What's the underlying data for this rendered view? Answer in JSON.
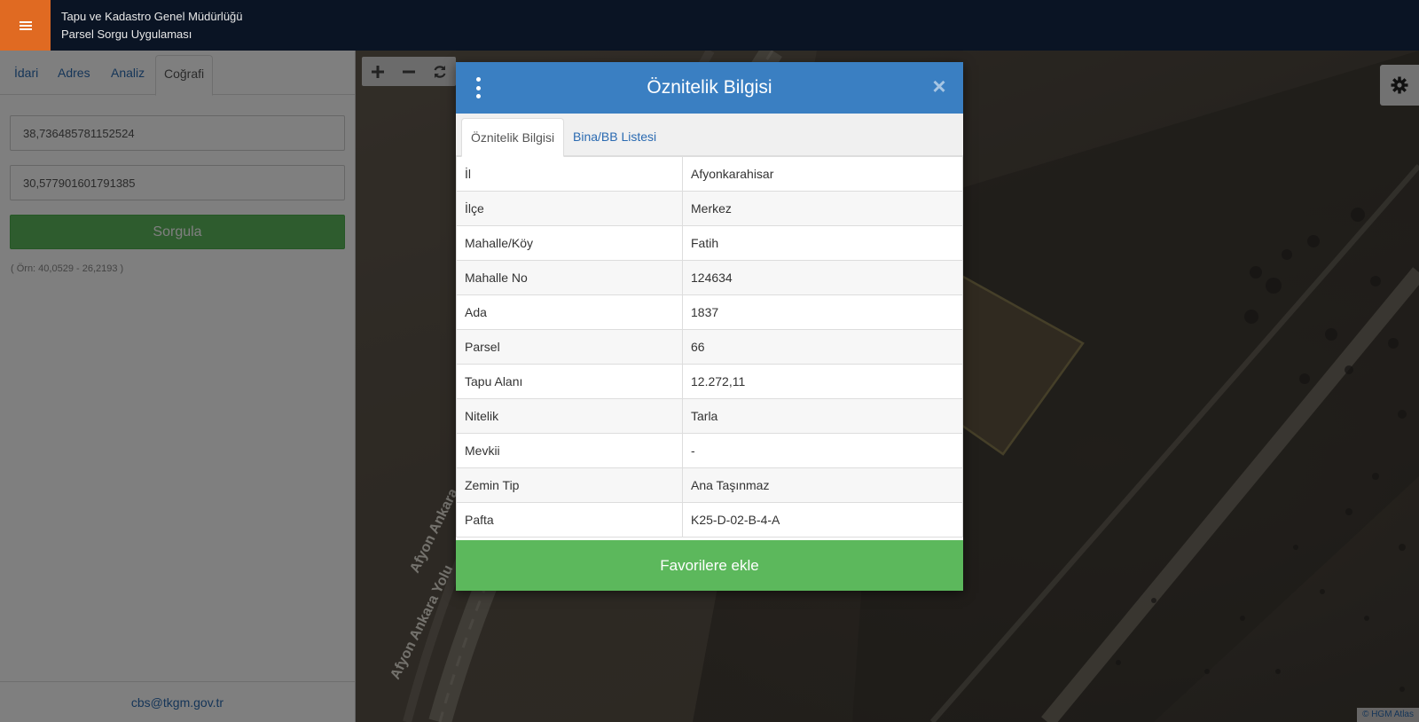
{
  "header": {
    "menu_icon": "hamburger-menu-icon",
    "title_line1": "Tapu ve Kadastro Genel Müdürlüğü",
    "title_line2": "Parsel Sorgu Uygulaması",
    "bg_color": "#0a1424",
    "accent_color": "#e06a22"
  },
  "left_panel": {
    "tabs": [
      {
        "label": "İdari"
      },
      {
        "label": "Adres"
      },
      {
        "label": "Analiz"
      },
      {
        "label": "Coğrafi",
        "active": true
      }
    ],
    "latitude_value": "38,736485781152524",
    "longitude_value": "30,577901601791385",
    "query_button": "Sorgula",
    "example_text": "( Örn: 40,0529 - 26,2193 )",
    "footer_email": "cbs@tkgm.gov.tr"
  },
  "map": {
    "toolbar_icons": [
      "zoom-in-icon",
      "zoom-out-icon",
      "refresh-icon"
    ],
    "road_label_1": "Afyon Ankara",
    "road_label_2": "Afyon Ankara Yolu",
    "settings_icon": "gear-icon",
    "attribution": "© HGM Atlas"
  },
  "modal": {
    "title": "Öznitelik Bilgisi",
    "menu_icon": "kebab-menu-icon",
    "close_icon": "close-icon",
    "tabs": [
      {
        "label": "Öznitelik Bilgisi",
        "active": true
      },
      {
        "label": "Bina/BB Listesi"
      }
    ],
    "rows": [
      {
        "key": "İl",
        "value": "Afyonkarahisar"
      },
      {
        "key": "İlçe",
        "value": "Merkez"
      },
      {
        "key": "Mahalle/Köy",
        "value": "Fatih"
      },
      {
        "key": "Mahalle No",
        "value": "124634"
      },
      {
        "key": "Ada",
        "value": "1837"
      },
      {
        "key": "Parsel",
        "value": "66"
      },
      {
        "key": "Tapu Alanı",
        "value": "12.272,11"
      },
      {
        "key": "Nitelik",
        "value": "Tarla"
      },
      {
        "key": "Mevkii",
        "value": "-"
      },
      {
        "key": "Zemin Tip",
        "value": "Ana Taşınmaz"
      },
      {
        "key": "Pafta",
        "value": "K25-D-02-B-4-A"
      }
    ],
    "favorite_button": "Favorilere ekle",
    "header_color": "#3a7fc2",
    "button_color": "#5cb85c"
  }
}
